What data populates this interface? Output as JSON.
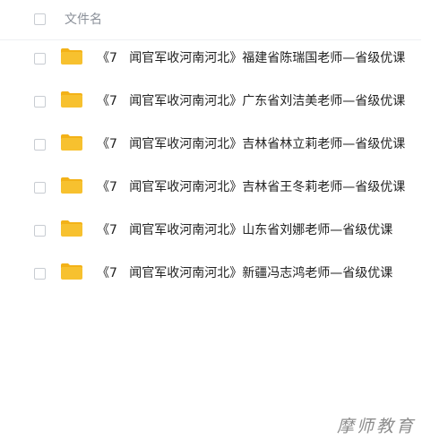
{
  "header": {
    "column_label": "文件名"
  },
  "files": [
    {
      "name": "《7   闻官军收河南河北》福建省陈瑞国老师—省级优课",
      "icon": "folder-icon"
    },
    {
      "name": "《7   闻官军收河南河北》广东省刘洁美老师—省级优课",
      "icon": "folder-icon"
    },
    {
      "name": "《7   闻官军收河南河北》吉林省林立莉老师—省级优课",
      "icon": "folder-icon"
    },
    {
      "name": "《7   闻官军收河南河北》吉林省王冬莉老师—省级优课",
      "icon": "folder-icon"
    },
    {
      "name": "《7   闻官军收河南河北》山东省刘娜老师—省级优课",
      "icon": "folder-icon"
    },
    {
      "name": "《7   闻官军收河南河北》新疆冯志鸿老师—省级优课",
      "icon": "folder-icon"
    }
  ],
  "watermark": "摩师教育",
  "colors": {
    "folder": "#f7c12f",
    "folder_tab": "#f3b218",
    "text": "#222222",
    "header_text": "#8a8f98"
  }
}
